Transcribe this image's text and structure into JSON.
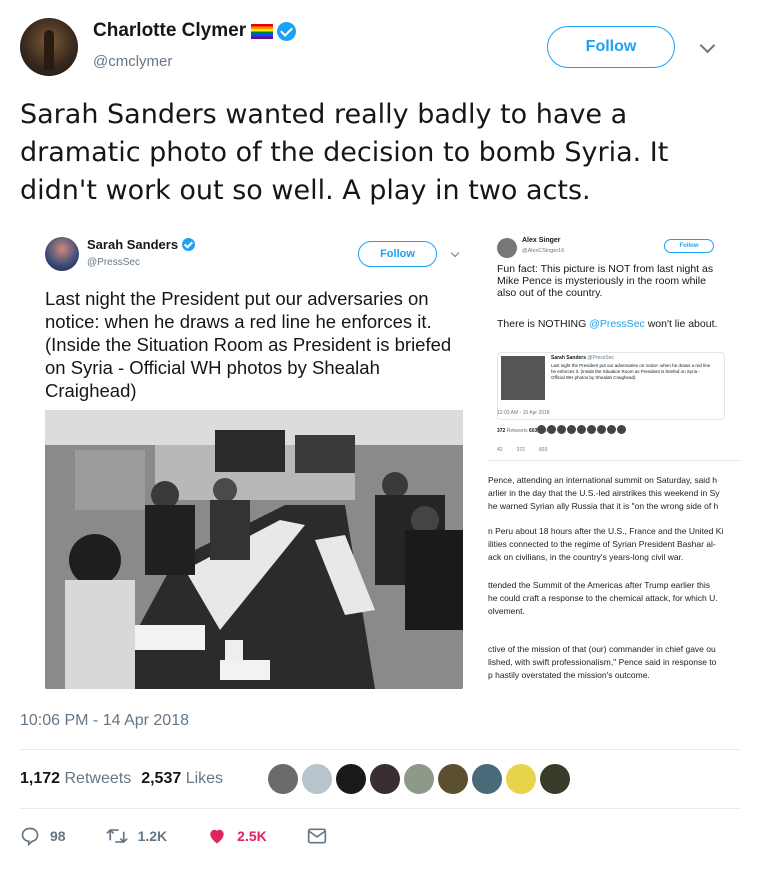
{
  "author": {
    "name": "Charlotte Clymer",
    "handle": "@cmclymer",
    "follow_label": "Follow"
  },
  "tweet": {
    "text": "Sarah Sanders wanted really badly to have a dramatic photo of the decision to bomb Syria. It didn't work out so well. A play in two acts.",
    "timestamp": "10:06 PM - 14 Apr 2018",
    "retweets_count": "1,172",
    "retweets_label": "Retweets",
    "likes_count": "2,537",
    "likes_label": "Likes"
  },
  "image1": {
    "name": "Sarah Sanders",
    "handle": "@PressSec",
    "follow_label": "Follow",
    "text": "Last night the President put our adversaries on notice: when he draws a red line he enforces it. (Inside the Situation Room as President is briefed on Syria - Official WH photos by Shealah Craighead)"
  },
  "image2": {
    "name": "Alex Singer",
    "handle": "@AlexCSinger16",
    "follow_label": "Follow",
    "text1": "Fun fact: This picture is NOT from last night as Mike Pence is mysteriously in the room while also out of the country.",
    "text2_a": "There is NOTHING ",
    "text2_mention": "@PressSec",
    "text2_b": " won't lie about.",
    "quote_name": "Sarah Sanders",
    "quote_handle": "@PressSec",
    "quote_text": "Last night the President put our adversaries on notice: when he draws a red line he enforces it. (Inside the Situation Room as President is briefed on Syria - Official WH photos by Shealah Craighead)",
    "quote_time": "12:03 AM - 15 Apr 2018",
    "quote_retweets": "372",
    "quote_retweets_label": "Retweets",
    "quote_likes": "603",
    "quote_likes_label": "Likes",
    "quote_replies": "42",
    "quote_rt_count": "372",
    "quote_like_count": "603",
    "article_lines": [
      "Pence, attending an international summit on Saturday, said h",
      "arlier in the day that the U.S.-led airstrikes this weekend in Sy",
      "he warned Syrian ally Russia that it is \"on the wrong side of h",
      "n Peru about 18 hours after the U.S., France and the United Ki",
      "ilities connected to the regime of Syrian President Bashar al-",
      "ack on civilians, in the country's years-long civil war.",
      "ttended the Summit of the Americas after Trump earlier this",
      "he could craft a response to the chemical attack, for which U.",
      "olvement.",
      "ctive of the mission of that (our) commander in chief gave ou",
      "lished, with swift professionalism,\" Pence said in response to",
      "p hastily overstated the mission's outcome."
    ]
  },
  "actions": {
    "replies": "98",
    "retweets": "1.2K",
    "likes": "2.5K"
  },
  "colors": {
    "accent": "#1da1f2",
    "like": "#e0245e",
    "muted": "#657786"
  }
}
